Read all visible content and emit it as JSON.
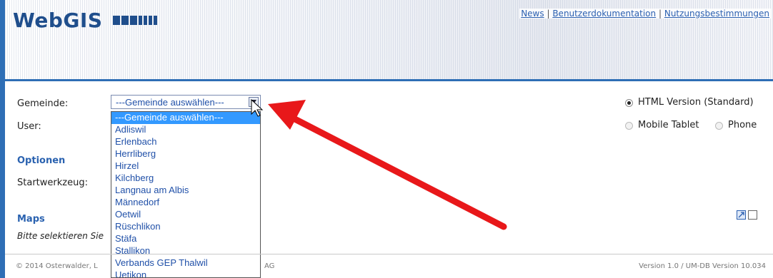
{
  "header": {
    "logo_text": "WebGIS",
    "links": [
      "News",
      "Benutzerdokumentation",
      "Nutzungsbestimmungen"
    ],
    "separator": "|"
  },
  "form": {
    "gemeinde_label": "Gemeinde:",
    "user_label": "User:",
    "optionen_heading": "Optionen",
    "startwerkzeug_label": "Startwerkzeug:",
    "maps_heading": "Maps",
    "maps_hint": "Bitte selektieren Sie",
    "gemeinde_select_value": "---Gemeinde auswählen---"
  },
  "dropdown": {
    "options": [
      "---Gemeinde auswählen---",
      "Adliswil",
      "Erlenbach",
      "Herrliberg",
      "Hirzel",
      "Kilchberg",
      "Langnau am Albis",
      "Männedorf",
      "Oetwil",
      "Rüschlikon",
      "Stäfa",
      "Stallikon",
      "Verbands GEP Thalwil",
      "Uetikon"
    ],
    "selected_index": 0
  },
  "versions": {
    "html": "HTML Version (Standard)",
    "mobile": "Mobile Tablet",
    "phone": "Phone",
    "selected": "html"
  },
  "footer": {
    "left": "© 2014 Osterwalder, L",
    "middle": "AG",
    "right": "Version 1.0 / UM-DB Version 10.034"
  },
  "colors": {
    "accent": "#2e6eb5",
    "link": "#2a5fb0",
    "selection": "#3399ff",
    "arrow": "#e8181a"
  },
  "icons": [
    "link-icon",
    "checkbox-icon"
  ]
}
